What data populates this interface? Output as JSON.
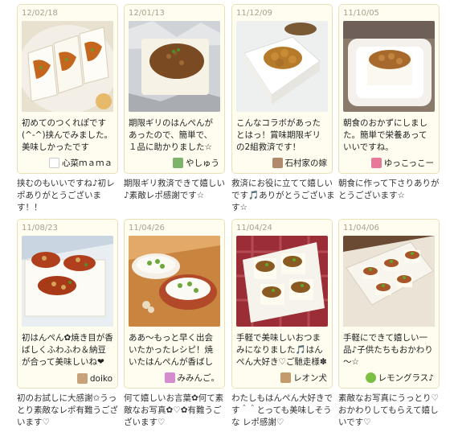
{
  "reports": [
    {
      "date": "12/02/18",
      "text": "初めてのつくれぽです(^-^)挟んでみました。美味しかったです",
      "user": "心菜ｍａｍａ",
      "avatar": "avatar-chef-icon",
      "reply": "挟むのもいいですね♪初レポありがとうございます！！"
    },
    {
      "date": "12/01/13",
      "text": "期限ギリのはんぺんがあったので、簡単で、１品に助かりました☆",
      "user": "やしゅう",
      "avatar": "avatar-pattern-icon",
      "reply": "期限ギリ救済できて嬉しい♪素敵レポ感謝です☆"
    },
    {
      "date": "11/12/09",
      "text": "こんなコラボがあったとはっ！賞味期限ギリの2組救済です！",
      "user": "石村家の嫁",
      "avatar": "avatar-photo-icon",
      "reply": "救済にお役に立てて嬉しいです🎵ありがとうございます☆"
    },
    {
      "date": "11/10/05",
      "text": "朝食のおかずにしました。簡単で栄養あっていいですね。",
      "user": "ゆっこっこー",
      "avatar": "avatar-flower-icon",
      "reply": "朝食に作って下さりありがとうございます☆"
    },
    {
      "date": "11/08/23",
      "text": "初はんぺん✿焼き目が香ばしくふわふわ＆納豆が合って美味しいね❤",
      "user": "doiko",
      "avatar": "avatar-photo-icon",
      "reply": "初のお試しに大感謝✩うっとり素敵なレポ有難うございます♡"
    },
    {
      "date": "11/04/26",
      "text": "ああ～もっと早く出会いたかったレシピ！焼いたはんぺんが香ばしい♪",
      "user": "みみんご。",
      "avatar": "avatar-cat-icon",
      "reply": "何て嬉しいお言葉✿何て素敵なお写真✿♡✿有難うございます♡"
    },
    {
      "date": "11/04/24",
      "text": "手軽で美味しいおつまみになりました🎵はんぺん大好き♡ご馳走様✽",
      "user": "レオン犬",
      "avatar": "avatar-dog-icon",
      "reply": "わたしもはんぺん大好きです＾＾とっても美味しそうな レポ感謝♡"
    },
    {
      "date": "11/04/06",
      "text": "手軽にできて嬉しい一品♪子供たちもおかわり～☆",
      "user": "レモングラス♪",
      "avatar": "avatar-leaf-icon",
      "reply": "素敵なお写真にうっとり♡おかわりしてもらえて嬉しいです♡"
    }
  ]
}
